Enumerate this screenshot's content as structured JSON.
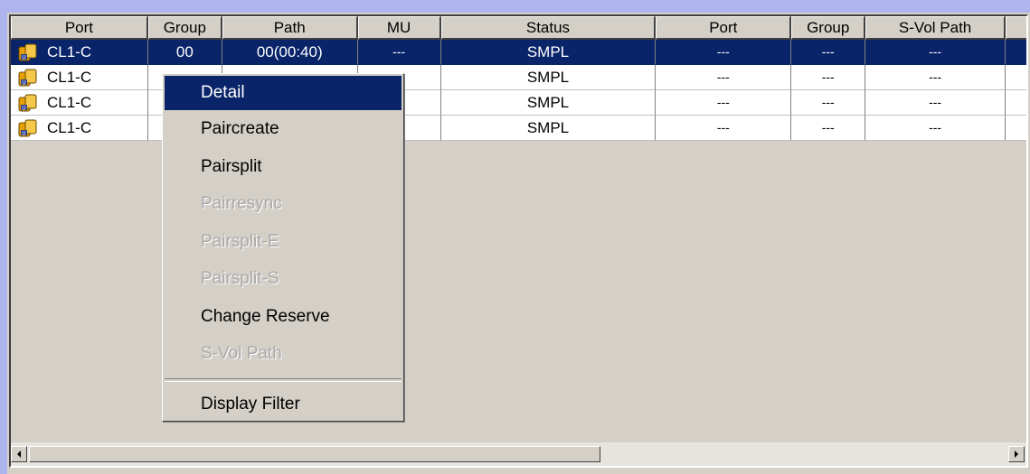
{
  "table": {
    "headers": [
      {
        "key": "port",
        "label": "Port"
      },
      {
        "key": "group",
        "label": "Group"
      },
      {
        "key": "path",
        "label": "Path"
      },
      {
        "key": "mu",
        "label": "MU"
      },
      {
        "key": "status",
        "label": "Status"
      },
      {
        "key": "port2",
        "label": "Port"
      },
      {
        "key": "group2",
        "label": "Group"
      },
      {
        "key": "svol",
        "label": "S-Vol Path"
      }
    ],
    "rows": [
      {
        "port": "CL1-C",
        "group": "00",
        "path": "00(00:40)",
        "mu": "---",
        "status": "SMPL",
        "port2": "---",
        "group2": "---",
        "svol": "---",
        "selected": true
      },
      {
        "port": "CL1-C",
        "group": "",
        "path": "",
        "mu": "---",
        "status": "SMPL",
        "port2": "---",
        "group2": "---",
        "svol": "---",
        "selected": false
      },
      {
        "port": "CL1-C",
        "group": "",
        "path": "",
        "mu": "---",
        "status": "SMPL",
        "port2": "---",
        "group2": "---",
        "svol": "---",
        "selected": false
      },
      {
        "port": "CL1-C",
        "group": "",
        "path": "",
        "mu": "---",
        "status": "SMPL",
        "port2": "---",
        "group2": "---",
        "svol": "---",
        "selected": false
      }
    ]
  },
  "context_menu": {
    "items": [
      {
        "label": "Detail",
        "enabled": true,
        "highlighted": true
      },
      {
        "label": "Paircreate",
        "enabled": true
      },
      {
        "label": "Pairsplit",
        "enabled": true
      },
      {
        "label": "Pairresync",
        "enabled": false
      },
      {
        "label": "Pairsplit-E",
        "enabled": false
      },
      {
        "label": "Pairsplit-S",
        "enabled": false
      },
      {
        "label": "Change Reserve",
        "enabled": true
      },
      {
        "label": "S-Vol Path",
        "enabled": false
      }
    ],
    "footer_item": {
      "label": "Display Filter",
      "enabled": true
    }
  },
  "scrollbar": {
    "left_icon": "arrow-left-icon",
    "right_icon": "arrow-right-icon"
  },
  "icons": {
    "row_icon": "volume-pair-icon"
  },
  "colors": {
    "selection": "#0a246a",
    "background": "#d4d0c8",
    "outer": "#aeb4ee"
  }
}
